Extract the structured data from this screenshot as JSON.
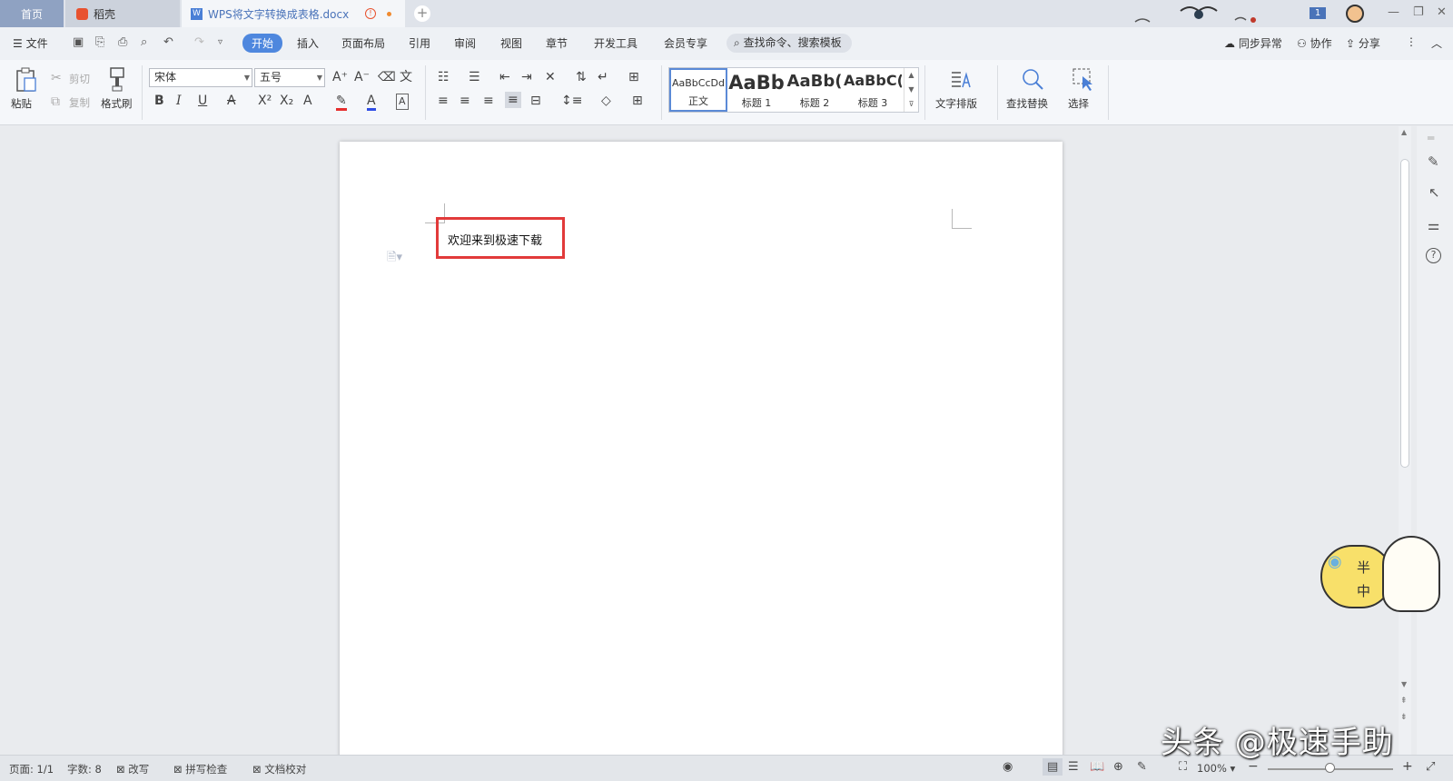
{
  "tabs": {
    "home": "首页",
    "daoke": "稻壳",
    "doc": "WPS将文字转换成表格.docx"
  },
  "menu": {
    "file": "文件",
    "items": [
      "开始",
      "插入",
      "页面布局",
      "引用",
      "审阅",
      "视图",
      "章节",
      "开发工具",
      "会员专享"
    ],
    "search": "查找命令、搜索模板",
    "sync": "同步异常",
    "collab": "协作",
    "share": "分享",
    "user_badge": "1"
  },
  "ribbon": {
    "paste": "粘贴",
    "cut": "剪切",
    "copy": "复制",
    "format_painter": "格式刷",
    "font_name": "宋体",
    "font_size": "五号",
    "styles": [
      {
        "preview": "AaBbCcDd",
        "label": "正文"
      },
      {
        "preview": "AaBb",
        "label": "标题 1"
      },
      {
        "preview": "AaBb(",
        "label": "标题 2"
      },
      {
        "preview": "AaBbC(",
        "label": "标题 3"
      }
    ],
    "text_layout": "文字排版",
    "find_replace": "查找替换",
    "select": "选择"
  },
  "document": {
    "text": "欢迎来到极速下载"
  },
  "status": {
    "page": "页面: 1/1",
    "words": "字数: 8",
    "revise": "改写",
    "spell": "拼写检查",
    "proof": "文档校对",
    "zoom": "100%"
  },
  "mascot": {
    "line1": "半",
    "line2": "中"
  },
  "watermark": "头条 @极速手助"
}
